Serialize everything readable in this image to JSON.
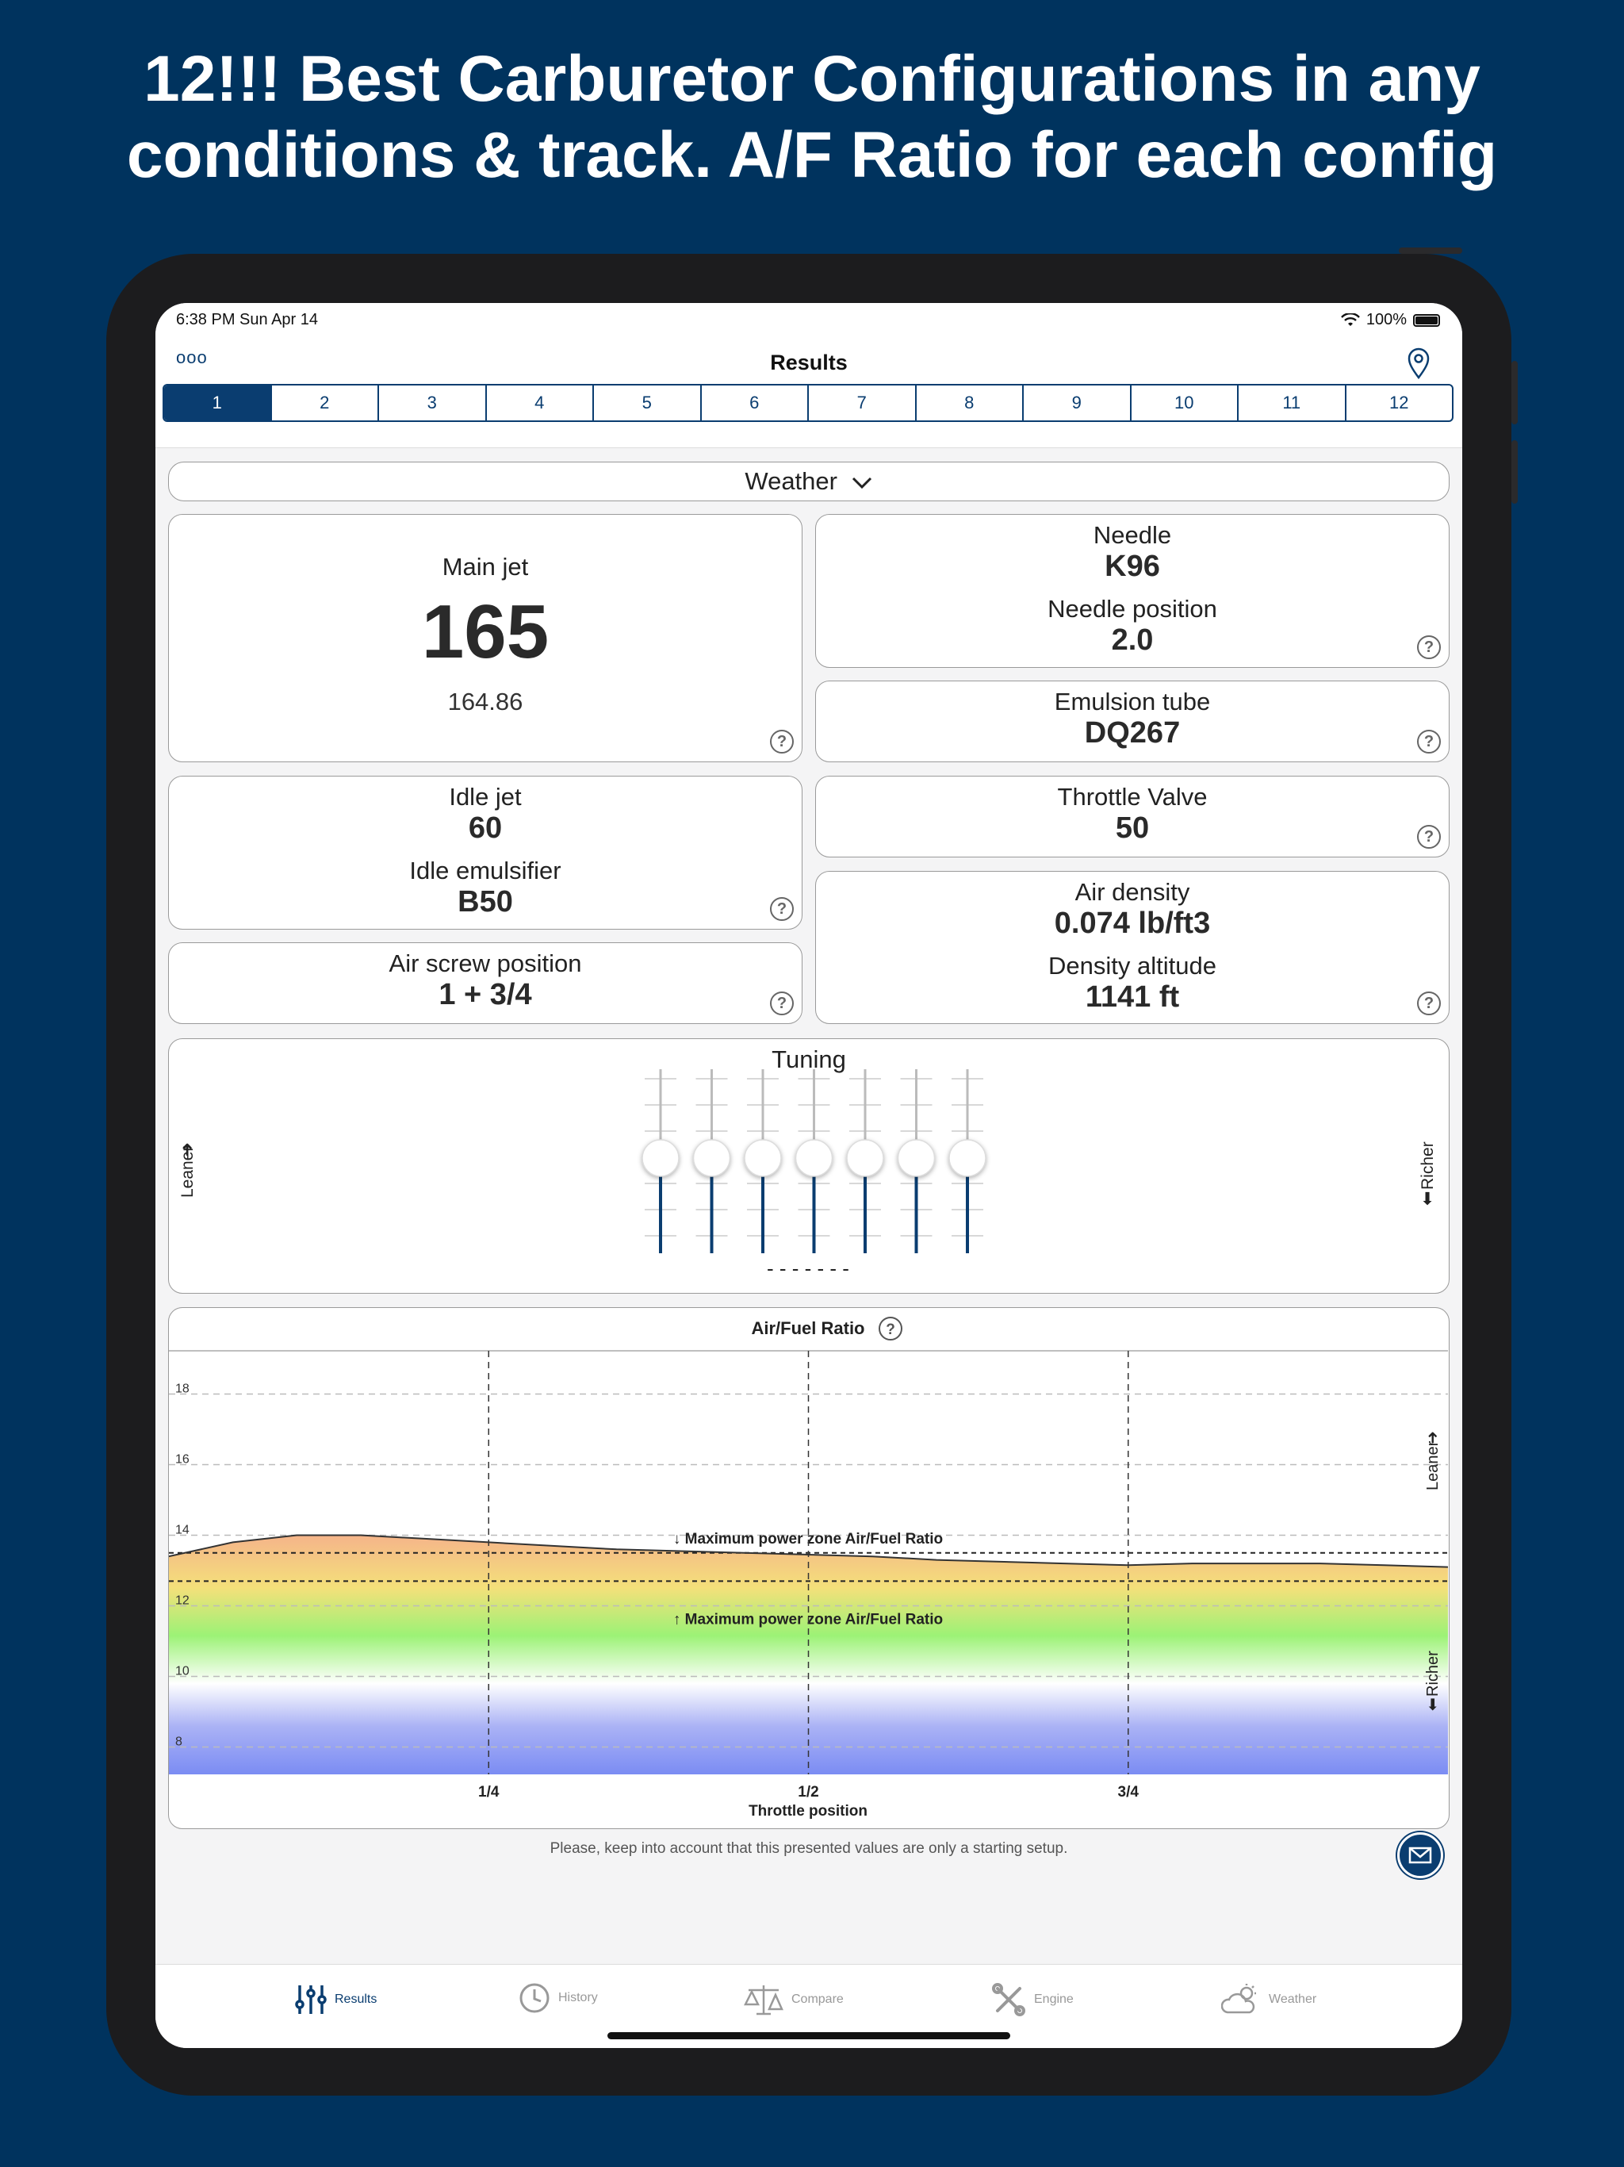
{
  "headline": {
    "line1": "12!!! Best Carburetor Configurations in any",
    "line2": "conditions & track. A/F Ratio for each config"
  },
  "status_bar": {
    "time": "6:38 PM  Sun Apr 14",
    "battery": "100%"
  },
  "nav": {
    "title": "Results",
    "more_icon": "ooo",
    "pin_icon": "location-pin-icon"
  },
  "segments": [
    "1",
    "2",
    "3",
    "4",
    "5",
    "6",
    "7",
    "8",
    "9",
    "10",
    "11",
    "12"
  ],
  "selected_segment": "1",
  "weather_dropdown": {
    "label": "Weather"
  },
  "main_jet": {
    "label": "Main jet",
    "value": "165",
    "precise": "164.86"
  },
  "needle": {
    "label": "Needle",
    "value": "K96",
    "position_label": "Needle position",
    "position_value": "2.0"
  },
  "emulsion_tube": {
    "label": "Emulsion tube",
    "value": "DQ267"
  },
  "idle_jet": {
    "label": "Idle jet",
    "value": "60",
    "emulsifier_label": "Idle emulsifier",
    "emulsifier_value": "B50"
  },
  "throttle_valve": {
    "label": "Throttle Valve",
    "value": "50"
  },
  "air_screw": {
    "label": "Air screw position",
    "value": "1 + 3/4"
  },
  "air_density": {
    "label": "Air density",
    "value": "0.074 lb/ft3",
    "altitude_label": "Density altitude",
    "altitude_value": "1141 ft"
  },
  "help_glyph": "?",
  "tuning": {
    "title": "Tuning",
    "leaner": "Leaner",
    "richer": "Richer",
    "slider_levels": [
      0.5,
      0.5,
      0.5,
      0.5,
      0.5,
      0.5,
      0.5
    ],
    "dash_text": "- - - - - - -"
  },
  "chart_data": {
    "type": "line",
    "title": "Air/Fuel Ratio",
    "xlabel": "Throttle position",
    "x_ticks": [
      "1/4",
      "1/2",
      "3/4"
    ],
    "y_ticks": [
      8,
      10,
      12,
      14,
      16,
      18
    ],
    "ylim": [
      7,
      19
    ],
    "xlim": [
      0,
      1
    ],
    "side_labels": {
      "upper": "Leaner",
      "lower": "Richer"
    },
    "max_power_zone": {
      "upper": 13.5,
      "lower": 12.7,
      "upper_label": "↓ Maximum power zone Air/Fuel Ratio",
      "lower_label": "↑ Maximum power zone Air/Fuel Ratio"
    },
    "series": [
      {
        "x": [
          0,
          0.05,
          0.1,
          0.15,
          0.2,
          0.25,
          0.3,
          0.35,
          0.4,
          0.45,
          0.5,
          0.55,
          0.6,
          0.65,
          0.7,
          0.75,
          0.8,
          0.85,
          0.9,
          0.95,
          1.0
        ],
        "values": [
          13.4,
          13.8,
          14.0,
          14.0,
          13.9,
          13.8,
          13.7,
          13.6,
          13.55,
          13.5,
          13.45,
          13.4,
          13.3,
          13.25,
          13.2,
          13.15,
          13.2,
          13.2,
          13.2,
          13.15,
          13.1
        ]
      }
    ],
    "grid": true
  },
  "disclaimer": "Please, keep into account that this presented values are only a starting setup.",
  "tabs": [
    {
      "label": "Results",
      "icon": "sliders-icon"
    },
    {
      "label": "History",
      "icon": "clock-icon"
    },
    {
      "label": "Compare",
      "icon": "scale-icon"
    },
    {
      "label": "Engine",
      "icon": "wrench-icon"
    },
    {
      "label": "Weather",
      "icon": "cloud-sun-icon"
    }
  ],
  "colors": {
    "brand": "#0a3d70",
    "background": "#00335e"
  }
}
